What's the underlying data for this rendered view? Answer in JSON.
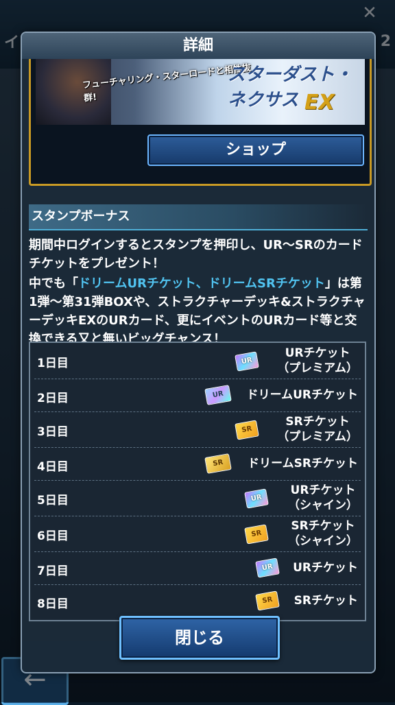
{
  "background": {
    "title": "イン",
    "right_number": "2",
    "back_label": "←"
  },
  "dialog": {
    "title": "詳細",
    "banner": {
      "tag_text": "フューチャリング・スターロードと相性抜群!",
      "logo_text": "スターダスト・ネクサス",
      "ex_text": "EX"
    },
    "shop_button": "ショップ",
    "section_title": "スタンプボーナス",
    "paragraph1": "期間中ログインするとスタンプを押印し、UR〜SRのカードチケットをプレゼント！",
    "paragraph2_prefix": "中でも「",
    "paragraph2_highlight": "ドリームURチケット、ドリームSRチケット",
    "paragraph2_suffix": "」は第1弾〜第31弾BOXや、ストラクチャーデッキ&ストラクチャーデッキEXのURカード、更にイベントのURカード等と交換できる又と無いビッグチャンス！",
    "rewards": [
      {
        "day": "1日目",
        "line1": "URチケット",
        "line2": "（プレミアム）",
        "icon": "ur-ticket-icon",
        "icon_text": "UR"
      },
      {
        "day": "2日目",
        "line1": "ドリームURチケット",
        "line2": "",
        "icon": "dream-ur-ticket-icon",
        "icon_text": "UR"
      },
      {
        "day": "3日目",
        "line1": "SRチケット",
        "line2": "（プレミアム）",
        "icon": "sr-ticket-icon",
        "icon_text": "SR"
      },
      {
        "day": "4日目",
        "line1": "ドリームSRチケット",
        "line2": "",
        "icon": "dream-sr-ticket-icon",
        "icon_text": "SR"
      },
      {
        "day": "5日目",
        "line1": "URチケット",
        "line2": "（シャイン）",
        "icon": "ur-ticket-icon",
        "icon_text": "UR"
      },
      {
        "day": "6日目",
        "line1": "SRチケット",
        "line2": "（シャイン）",
        "icon": "sr-ticket-icon",
        "icon_text": "SR"
      },
      {
        "day": "7日目",
        "line1": "URチケット",
        "line2": "",
        "icon": "ur-ticket-icon",
        "icon_text": "UR"
      },
      {
        "day": "8日目",
        "line1": "SRチケット",
        "line2": "",
        "icon": "sr-ticket-icon",
        "icon_text": "SR"
      }
    ],
    "close_button": "閉じる"
  }
}
